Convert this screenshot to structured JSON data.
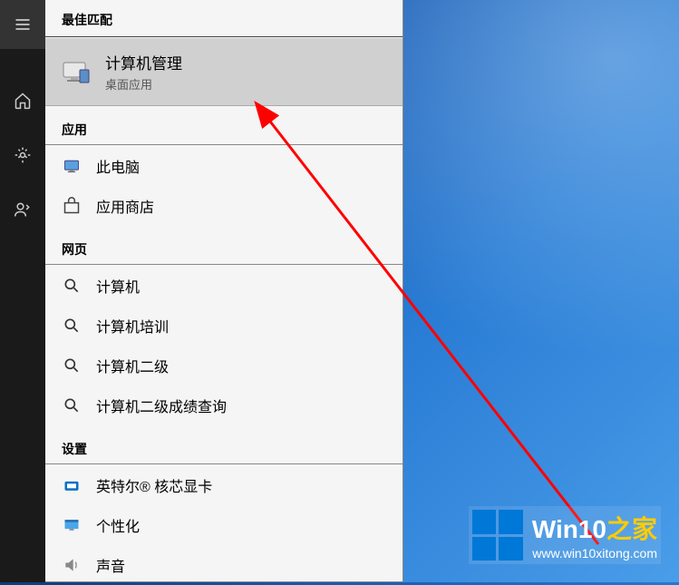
{
  "sections": {
    "best_match_header": "最佳匹配",
    "apps_header": "应用",
    "web_header": "网页",
    "settings_header": "设置"
  },
  "best_match": {
    "title": "计算机管理",
    "subtitle": "桌面应用"
  },
  "apps": [
    {
      "label": "此电脑",
      "icon": "computer-icon"
    },
    {
      "label": "应用商店",
      "icon": "store-icon"
    }
  ],
  "web": [
    {
      "label": "计算机"
    },
    {
      "label": "计算机培训"
    },
    {
      "label": "计算机二级"
    },
    {
      "label": "计算机二级成绩查询"
    }
  ],
  "settings": [
    {
      "label": "英特尔® 核芯显卡",
      "icon": "intel-icon"
    },
    {
      "label": "个性化",
      "icon": "personalize-icon"
    },
    {
      "label": "声音",
      "icon": "sound-icon"
    }
  ],
  "watermark": {
    "title_prefix": "Win10",
    "title_suffix": "之家",
    "url": "www.win10xitong.com"
  }
}
